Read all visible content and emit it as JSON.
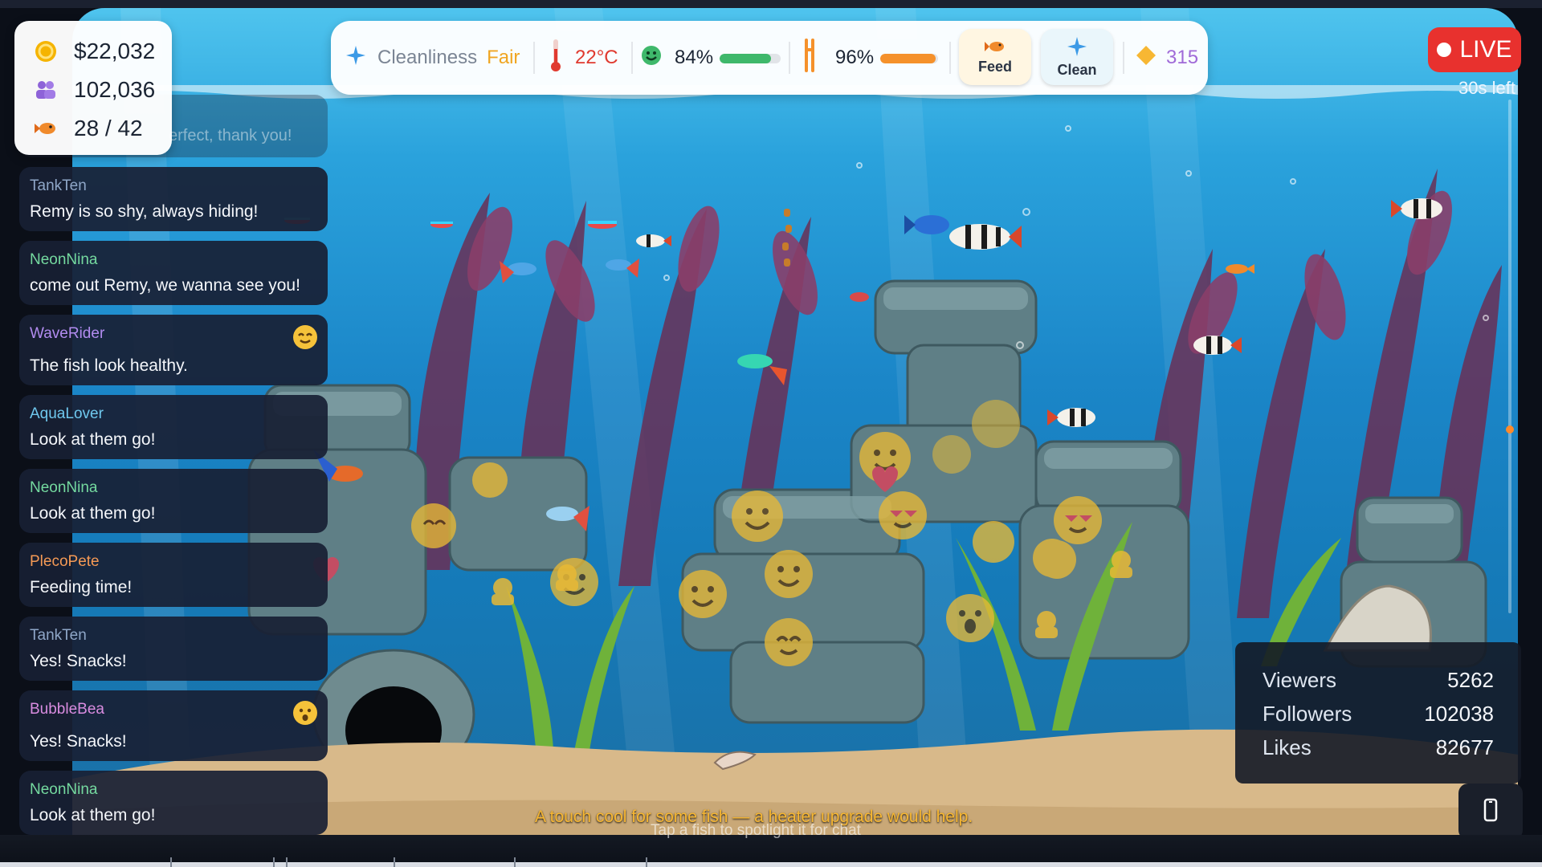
{
  "stats": {
    "coins": "$22,032",
    "followers": "102,036",
    "fish_count": "28 / 42",
    "icons": [
      "coin-icon",
      "people-icon",
      "fish-icon"
    ]
  },
  "status_bar": {
    "cleanliness_label": "Cleanliness",
    "cleanliness_value": "Fair",
    "temperature": "22°C",
    "happiness": "84%",
    "happiness_level": 0.84,
    "food": "96%",
    "food_level": 0.96,
    "feed_label": "Feed",
    "clean_label": "Clean",
    "gems": "315",
    "colors": {
      "cleanliness": "#f0a521",
      "temperature": "#e03a2f",
      "happiness_bar": "#3fb86b",
      "food_bar": "#f5912b",
      "gems": "#a06ad8"
    }
  },
  "live": {
    "label": "LIVE",
    "timer": "30s left"
  },
  "chat": {
    "faded_text": "erfect, thank you!",
    "messages": [
      {
        "user": "TankTen",
        "text": "Remy is so shy, always hiding!",
        "color": "#8fa7c8"
      },
      {
        "user": "NeonNina",
        "text": "come out Remy, we wanna see you!",
        "color": "#74d99f"
      },
      {
        "user": "WaveRider",
        "text": "The fish look healthy.",
        "color": "#b28cf0"
      },
      {
        "user": "AquaLover",
        "text": "Look at them go!",
        "color": "#6fc8ee"
      },
      {
        "user": "NeonNina",
        "text": "Look at them go!",
        "color": "#74d99f"
      },
      {
        "user": "PlecoPete",
        "text": "Feeding time!",
        "color": "#f59a55"
      },
      {
        "user": "TankTen",
        "text": "Yes! Snacks!",
        "color": "#8fa7c8"
      },
      {
        "user": "BubbleBea",
        "text": "Yes! Snacks!",
        "color": "#d98ce0"
      },
      {
        "user": "NeonNina",
        "text": "Look at them go!",
        "color": "#74d99f"
      }
    ]
  },
  "stream_stats": {
    "viewers_label": "Viewers",
    "viewers": "5262",
    "followers_label": "Followers",
    "followers": "102038",
    "likes_label": "Likes",
    "likes": "82677"
  },
  "caption": "A touch cool for some fish — a heater upgrade would help.",
  "hint": "Tap a fish to spotlight it for chat"
}
